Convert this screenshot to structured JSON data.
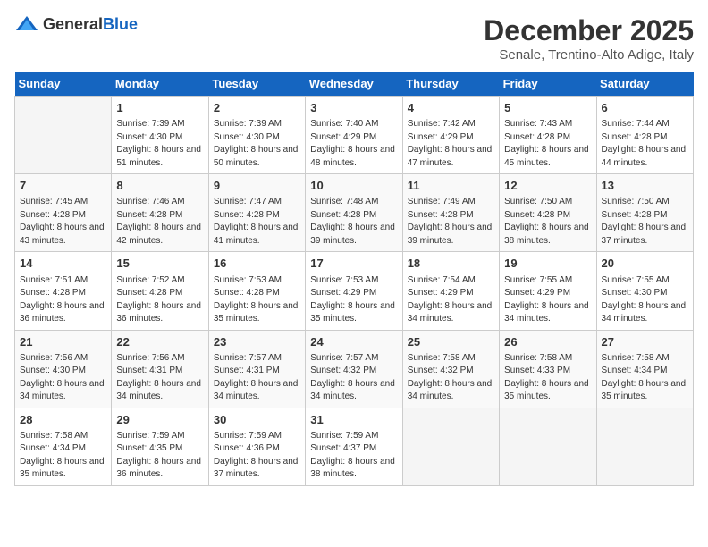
{
  "logo": {
    "text_general": "General",
    "text_blue": "Blue"
  },
  "title": "December 2025",
  "subtitle": "Senale, Trentino-Alto Adige, Italy",
  "days_of_week": [
    "Sunday",
    "Monday",
    "Tuesday",
    "Wednesday",
    "Thursday",
    "Friday",
    "Saturday"
  ],
  "weeks": [
    [
      {
        "day": "",
        "sunrise": "",
        "sunset": "",
        "daylight": ""
      },
      {
        "day": "1",
        "sunrise": "Sunrise: 7:39 AM",
        "sunset": "Sunset: 4:30 PM",
        "daylight": "Daylight: 8 hours and 51 minutes."
      },
      {
        "day": "2",
        "sunrise": "Sunrise: 7:39 AM",
        "sunset": "Sunset: 4:30 PM",
        "daylight": "Daylight: 8 hours and 50 minutes."
      },
      {
        "day": "3",
        "sunrise": "Sunrise: 7:40 AM",
        "sunset": "Sunset: 4:29 PM",
        "daylight": "Daylight: 8 hours and 48 minutes."
      },
      {
        "day": "4",
        "sunrise": "Sunrise: 7:42 AM",
        "sunset": "Sunset: 4:29 PM",
        "daylight": "Daylight: 8 hours and 47 minutes."
      },
      {
        "day": "5",
        "sunrise": "Sunrise: 7:43 AM",
        "sunset": "Sunset: 4:28 PM",
        "daylight": "Daylight: 8 hours and 45 minutes."
      },
      {
        "day": "6",
        "sunrise": "Sunrise: 7:44 AM",
        "sunset": "Sunset: 4:28 PM",
        "daylight": "Daylight: 8 hours and 44 minutes."
      }
    ],
    [
      {
        "day": "7",
        "sunrise": "Sunrise: 7:45 AM",
        "sunset": "Sunset: 4:28 PM",
        "daylight": "Daylight: 8 hours and 43 minutes."
      },
      {
        "day": "8",
        "sunrise": "Sunrise: 7:46 AM",
        "sunset": "Sunset: 4:28 PM",
        "daylight": "Daylight: 8 hours and 42 minutes."
      },
      {
        "day": "9",
        "sunrise": "Sunrise: 7:47 AM",
        "sunset": "Sunset: 4:28 PM",
        "daylight": "Daylight: 8 hours and 41 minutes."
      },
      {
        "day": "10",
        "sunrise": "Sunrise: 7:48 AM",
        "sunset": "Sunset: 4:28 PM",
        "daylight": "Daylight: 8 hours and 39 minutes."
      },
      {
        "day": "11",
        "sunrise": "Sunrise: 7:49 AM",
        "sunset": "Sunset: 4:28 PM",
        "daylight": "Daylight: 8 hours and 39 minutes."
      },
      {
        "day": "12",
        "sunrise": "Sunrise: 7:50 AM",
        "sunset": "Sunset: 4:28 PM",
        "daylight": "Daylight: 8 hours and 38 minutes."
      },
      {
        "day": "13",
        "sunrise": "Sunrise: 7:50 AM",
        "sunset": "Sunset: 4:28 PM",
        "daylight": "Daylight: 8 hours and 37 minutes."
      }
    ],
    [
      {
        "day": "14",
        "sunrise": "Sunrise: 7:51 AM",
        "sunset": "Sunset: 4:28 PM",
        "daylight": "Daylight: 8 hours and 36 minutes."
      },
      {
        "day": "15",
        "sunrise": "Sunrise: 7:52 AM",
        "sunset": "Sunset: 4:28 PM",
        "daylight": "Daylight: 8 hours and 36 minutes."
      },
      {
        "day": "16",
        "sunrise": "Sunrise: 7:53 AM",
        "sunset": "Sunset: 4:28 PM",
        "daylight": "Daylight: 8 hours and 35 minutes."
      },
      {
        "day": "17",
        "sunrise": "Sunrise: 7:53 AM",
        "sunset": "Sunset: 4:29 PM",
        "daylight": "Daylight: 8 hours and 35 minutes."
      },
      {
        "day": "18",
        "sunrise": "Sunrise: 7:54 AM",
        "sunset": "Sunset: 4:29 PM",
        "daylight": "Daylight: 8 hours and 34 minutes."
      },
      {
        "day": "19",
        "sunrise": "Sunrise: 7:55 AM",
        "sunset": "Sunset: 4:29 PM",
        "daylight": "Daylight: 8 hours and 34 minutes."
      },
      {
        "day": "20",
        "sunrise": "Sunrise: 7:55 AM",
        "sunset": "Sunset: 4:30 PM",
        "daylight": "Daylight: 8 hours and 34 minutes."
      }
    ],
    [
      {
        "day": "21",
        "sunrise": "Sunrise: 7:56 AM",
        "sunset": "Sunset: 4:30 PM",
        "daylight": "Daylight: 8 hours and 34 minutes."
      },
      {
        "day": "22",
        "sunrise": "Sunrise: 7:56 AM",
        "sunset": "Sunset: 4:31 PM",
        "daylight": "Daylight: 8 hours and 34 minutes."
      },
      {
        "day": "23",
        "sunrise": "Sunrise: 7:57 AM",
        "sunset": "Sunset: 4:31 PM",
        "daylight": "Daylight: 8 hours and 34 minutes."
      },
      {
        "day": "24",
        "sunrise": "Sunrise: 7:57 AM",
        "sunset": "Sunset: 4:32 PM",
        "daylight": "Daylight: 8 hours and 34 minutes."
      },
      {
        "day": "25",
        "sunrise": "Sunrise: 7:58 AM",
        "sunset": "Sunset: 4:32 PM",
        "daylight": "Daylight: 8 hours and 34 minutes."
      },
      {
        "day": "26",
        "sunrise": "Sunrise: 7:58 AM",
        "sunset": "Sunset: 4:33 PM",
        "daylight": "Daylight: 8 hours and 35 minutes."
      },
      {
        "day": "27",
        "sunrise": "Sunrise: 7:58 AM",
        "sunset": "Sunset: 4:34 PM",
        "daylight": "Daylight: 8 hours and 35 minutes."
      }
    ],
    [
      {
        "day": "28",
        "sunrise": "Sunrise: 7:58 AM",
        "sunset": "Sunset: 4:34 PM",
        "daylight": "Daylight: 8 hours and 35 minutes."
      },
      {
        "day": "29",
        "sunrise": "Sunrise: 7:59 AM",
        "sunset": "Sunset: 4:35 PM",
        "daylight": "Daylight: 8 hours and 36 minutes."
      },
      {
        "day": "30",
        "sunrise": "Sunrise: 7:59 AM",
        "sunset": "Sunset: 4:36 PM",
        "daylight": "Daylight: 8 hours and 37 minutes."
      },
      {
        "day": "31",
        "sunrise": "Sunrise: 7:59 AM",
        "sunset": "Sunset: 4:37 PM",
        "daylight": "Daylight: 8 hours and 38 minutes."
      },
      {
        "day": "",
        "sunrise": "",
        "sunset": "",
        "daylight": ""
      },
      {
        "day": "",
        "sunrise": "",
        "sunset": "",
        "daylight": ""
      },
      {
        "day": "",
        "sunrise": "",
        "sunset": "",
        "daylight": ""
      }
    ]
  ]
}
